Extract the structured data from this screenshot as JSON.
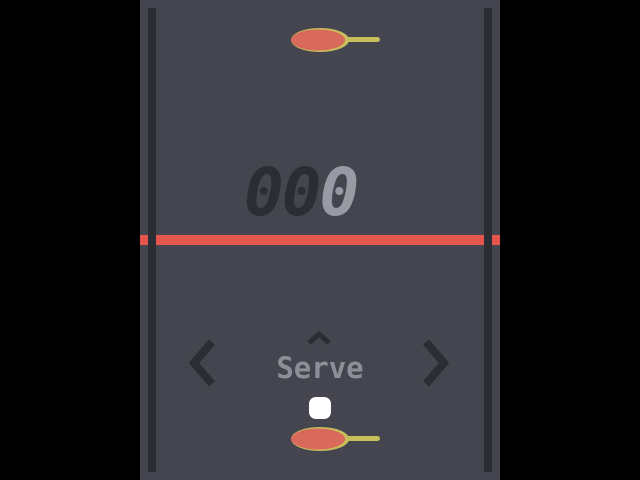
{
  "game": {
    "score": {
      "dim_digits": "00",
      "lit_digit": "0"
    },
    "controls": {
      "action_label": "Serve",
      "left_arrow_icon": "chevron-left-icon",
      "right_arrow_icon": "chevron-right-icon",
      "up_arrow_icon": "caret-up-icon"
    },
    "objects": {
      "paddle_icon": "ping-pong-paddle-icon",
      "ball_icon": "ball-icon"
    }
  },
  "colors": {
    "background": "#000000",
    "court": "#45454f",
    "wall": "#2c2c34",
    "net": "#e5584b",
    "paddle_head": "#d9695a",
    "paddle_handle": "#c9be5c",
    "score_dim": "#2c2c34",
    "score_lit": "#9a9aa4",
    "label": "#8e8e98",
    "ball": "#ffffff"
  }
}
